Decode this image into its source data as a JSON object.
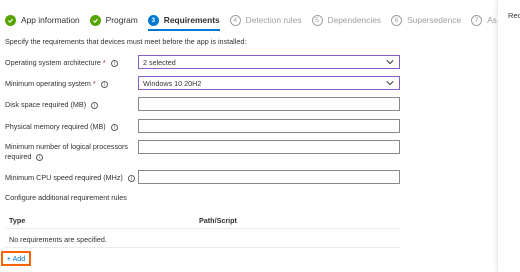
{
  "steps": [
    {
      "label": "App information",
      "status": "done",
      "marker": ""
    },
    {
      "label": "Program",
      "status": "done",
      "marker": ""
    },
    {
      "label": "Requirements",
      "status": "current",
      "marker": "3"
    },
    {
      "label": "Detection rules",
      "status": "future",
      "marker": "4"
    },
    {
      "label": "Dependencies",
      "status": "future",
      "marker": "5"
    },
    {
      "label": "Supersedence",
      "status": "future",
      "marker": "6"
    },
    {
      "label": "Assignments",
      "status": "future",
      "marker": "7"
    }
  ],
  "right_pane": {
    "label": "Requ"
  },
  "intro": "Specify the requirements that devices must meet before the app is installed:",
  "fields": {
    "os_arch": {
      "label": "Operating system architecture",
      "required": "*",
      "value": "2 selected"
    },
    "min_os": {
      "label": "Minimum operating system",
      "required": "*",
      "value": "Windows 10 20H2"
    },
    "disk_space": {
      "label": "Disk space required (MB)",
      "value": ""
    },
    "memory": {
      "label": "Physical memory required (MB)",
      "value": ""
    },
    "processors": {
      "label_line1": "Minimum number of logical processors",
      "label_line2": "required",
      "value": ""
    },
    "cpu_speed": {
      "label": "Minimum CPU speed required (MHz)",
      "value": ""
    }
  },
  "info_glyph": "i",
  "additional": {
    "label": "Configure additional requirement rules",
    "columns": [
      "Type",
      "Path/Script"
    ],
    "empty_message": "No requirements are specified."
  },
  "add_button": "+ Add",
  "colors": {
    "accent": "#0078d4",
    "done": "#57a300",
    "highlight": "#f7630c",
    "select_border": "#8661c5"
  }
}
